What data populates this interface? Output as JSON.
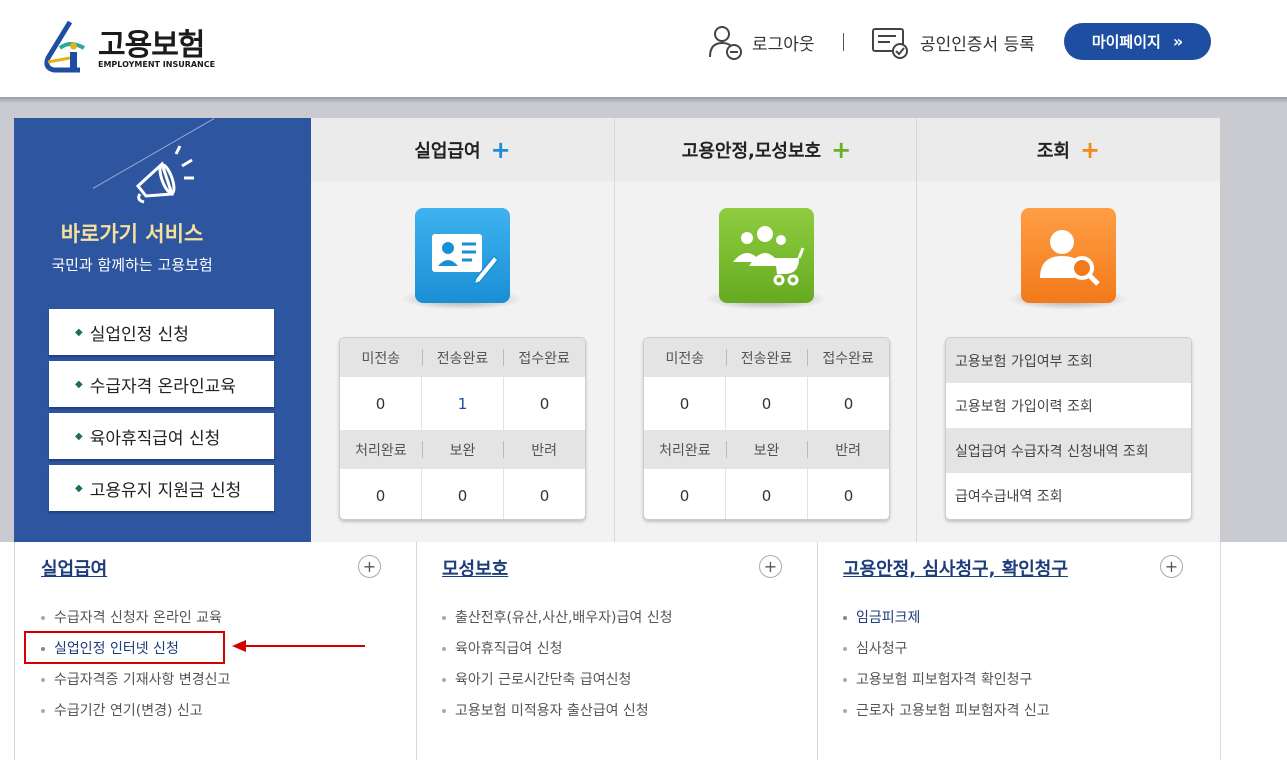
{
  "header": {
    "logo_text": "고용보험",
    "logo_sub": "EMPLOYMENT INSURANCE",
    "logout_label": "로그아웃",
    "cert_label": "공인인증서 등록",
    "mypage_label": "마이페이지",
    "mypage_chevron": "»"
  },
  "quick": {
    "title": "바로가기 서비스",
    "subtitle": "국민과 함께하는 고용보험",
    "buttons": [
      {
        "label": "실업인정 신청"
      },
      {
        "label": "수급자격 온라인교육"
      },
      {
        "label": "육아휴직급여 신청"
      },
      {
        "label": "고용유지 지원금 신청"
      }
    ]
  },
  "columns": [
    {
      "title": "실업급여",
      "plus_color": "#1e8fd6",
      "icon": "id-card-edit-icon",
      "icon_color": "#29a0e0",
      "stats_head_1": [
        "미전송",
        "전송완료",
        "접수완료"
      ],
      "stats_val_1": [
        "0",
        "1",
        "0"
      ],
      "stats_head_2": [
        "처리완료",
        "보완",
        "반려"
      ],
      "stats_val_2": [
        "0",
        "0",
        "0"
      ]
    },
    {
      "title": "고용안정,모성보호",
      "plus_color": "#6aae2a",
      "icon": "family-stroller-icon",
      "icon_color": "#7dbd33",
      "stats_head_1": [
        "미전송",
        "전송완료",
        "접수완료"
      ],
      "stats_val_1": [
        "0",
        "0",
        "0"
      ],
      "stats_head_2": [
        "처리완료",
        "보완",
        "반려"
      ],
      "stats_val_2": [
        "0",
        "0",
        "0"
      ]
    },
    {
      "title": "조회",
      "plus_color": "#f08a1c",
      "icon": "person-search-icon",
      "icon_color": "#f58a2c",
      "inquiries": [
        "고용보험 가입여부 조회",
        "고용보험 가입이력 조회",
        "실업급여 수급자격 신청내역 조회",
        "급여수급내역 조회"
      ]
    }
  ],
  "lists": [
    {
      "title": "실업급여",
      "items": [
        "수급자격 신청자 온라인 교육",
        "실업인정 인터넷 신청",
        "수급자격증 기재사항 변경신고",
        "수급기간 연기(변경) 신고"
      ]
    },
    {
      "title": "모성보호",
      "items": [
        "출산전후(유산,사산,배우자)급여 신청",
        "육아휴직급여 신청",
        "육아기 근로시간단축 급여신청",
        "고용보험 미적용자 출산급여 신청"
      ]
    },
    {
      "title": "고용안정, 심사청구, 확인청구",
      "items": [
        "임금피크제",
        "심사청구",
        "고용보험 피보험자격 확인청구",
        "근로자 고용보험 피보험자격 신고"
      ]
    }
  ],
  "list_plus_symbol": "+",
  "accent": {
    "primary": "#1d4ea1",
    "panel": "#2d55a0",
    "highlight": "#d20000"
  }
}
